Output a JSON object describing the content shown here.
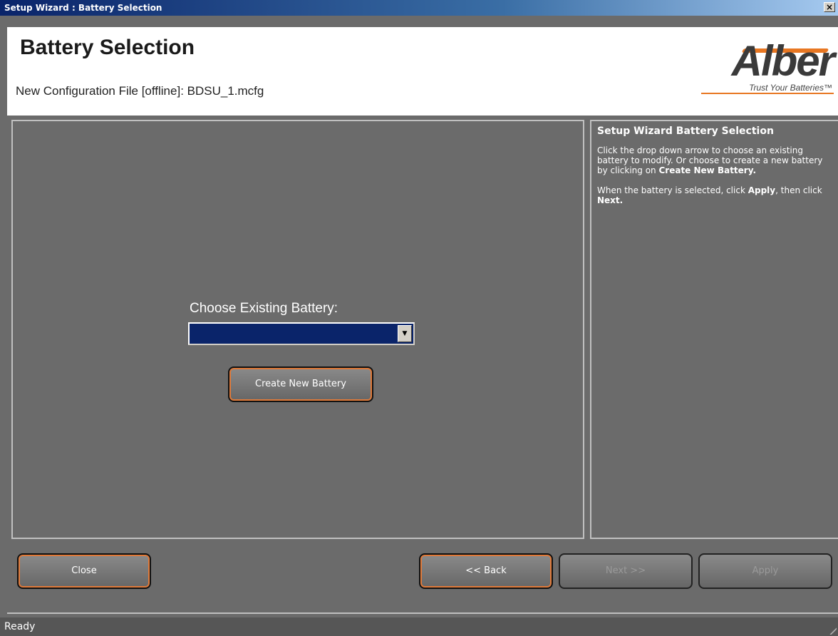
{
  "window": {
    "title": "Setup Wizard : Battery Selection",
    "close_glyph": "×"
  },
  "header": {
    "title": "Battery Selection",
    "subtitle": "New Configuration File [offline]: BDSU_1.mcfg",
    "logo": {
      "name": "Alber",
      "tagline": "Trust Your Batteries™"
    }
  },
  "main": {
    "choose_label": "Choose Existing Battery:",
    "dropdown_value": "",
    "create_button": "Create New Battery"
  },
  "help": {
    "title": "Setup Wizard Battery Selection",
    "p1_text1": "Click the drop down arrow to choose an existing battery to modify. Or choose to create a new battery by clicking on ",
    "p1_bold": "Create New Battery.",
    "p2_text1": "When the battery is selected, click ",
    "p2_bold1": "Apply",
    "p2_text2": ", then click ",
    "p2_bold2": "Next."
  },
  "buttons": {
    "close": "Close",
    "back": "<< Back",
    "next": "Next >>",
    "apply": "Apply"
  },
  "status": {
    "text": "Ready"
  },
  "colors": {
    "accent_orange": "#e07a3a",
    "dropdown_fill": "#0a246a",
    "panel_bg": "#6b6b6b"
  }
}
